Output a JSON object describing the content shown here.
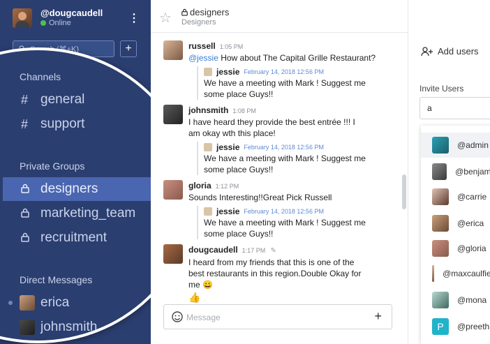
{
  "user": {
    "username": "@dougcaudell",
    "status": "Online"
  },
  "sidebar": {
    "search_placeholder": "Search (⌘+K)",
    "channels_title": "Channels",
    "channels": [
      "general",
      "support"
    ],
    "private_title": "Private Groups",
    "private_groups": [
      "designers",
      "marketing_team",
      "recruitment"
    ],
    "active_group": "designers",
    "dm_title": "Direct Messages",
    "direct_messages": [
      "erica",
      "johnsmith"
    ]
  },
  "room": {
    "name": "designers",
    "subtitle": "Designers"
  },
  "messages": [
    {
      "author": "russell",
      "time": "1:05 PM",
      "mention": "@jessie",
      "text": " How about The Capital Grille Restaurant?",
      "quote": {
        "author": "jessie",
        "time": "February 14, 2018 12:56 PM",
        "text": "We have a meeting with Mark ! Suggest me some place Guys!!"
      }
    },
    {
      "author": "johnsmith",
      "time": "1:08 PM",
      "text": "I have heard they provide the best entrée !!! I am okay wth this place!",
      "quote": {
        "author": "jessie",
        "time": "February 14, 2018 12:56 PM",
        "text": "We have a meeting with Mark ! Suggest me some place Guys!!"
      }
    },
    {
      "author": "gloria",
      "time": "1:12 PM",
      "text": "Sounds Interesting!!Great Pick Russell",
      "quote": {
        "author": "jessie",
        "time": "February 14, 2018 12:56 PM",
        "text": "We have a meeting with Mark ! Suggest me some place Guys!!"
      }
    },
    {
      "author": "dougcaudell",
      "time": "1:17 PM",
      "text": "I heard from my friends that this is one of the best restaurants in this region.Double Okay for me 😀",
      "reaction": "👍"
    }
  ],
  "composer": {
    "placeholder": "Message"
  },
  "right_panel": {
    "add_users": "Add users",
    "invite_label": "Invite Users",
    "invite_value": "a",
    "suggestions": [
      "@admin",
      "@benjamin",
      "@carrie",
      "@erica",
      "@gloria",
      "@maxcaulfield",
      "@mona",
      "@preethi"
    ]
  }
}
